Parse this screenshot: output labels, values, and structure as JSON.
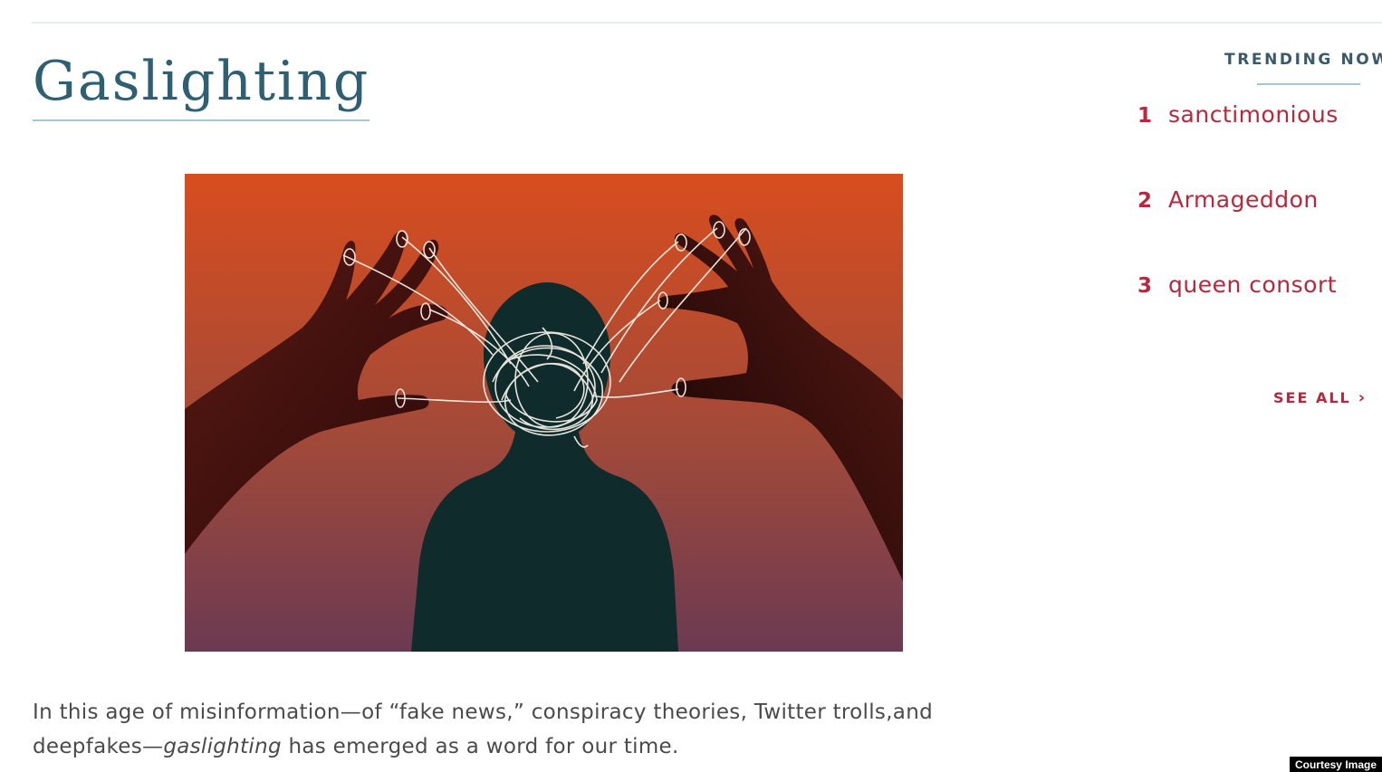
{
  "entry": {
    "title": "Gaslighting",
    "definition_part1": "In this age of misinformation—of “fake news,” conspiracy theories, Twitter trolls,and deepfakes—",
    "definition_emphasis": "gaslighting",
    "definition_part2": " has emerged as a word for our time."
  },
  "illustration": {
    "description_icon": "puppet-hands-tangled-strings-illustration",
    "colors": {
      "top": "#d84d1e",
      "middle": "#a24a39",
      "bottom": "#6b3a52",
      "silhouette_hands": "#3a0c0c",
      "silhouette_person": "#0f2b2b",
      "strings": "#f2efe6"
    }
  },
  "trending": {
    "heading": "TRENDING NOW",
    "items": [
      {
        "rank": "1",
        "word": "sanctimonious"
      },
      {
        "rank": "2",
        "word": "Armageddon"
      },
      {
        "rank": "3",
        "word": "queen consort"
      }
    ],
    "see_all": "SEE ALL",
    "see_all_icon": "chevron-right-icon"
  },
  "credit": "Courtesy Image",
  "colors": {
    "title": "#2f5f73",
    "accent": "#b8283c",
    "heading": "#3a5a6b",
    "body_text": "#4a4a4a",
    "rule": "#a8c6d2"
  }
}
